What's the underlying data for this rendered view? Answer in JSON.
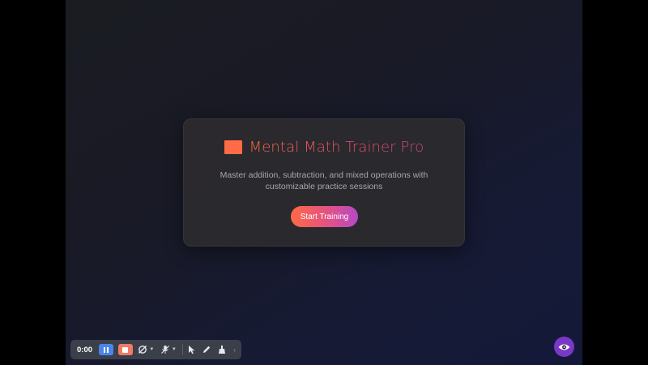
{
  "app": {
    "title": "Mental Math Trainer Pro",
    "subtitle": "Master addition, subtraction, and mixed operations with customizable practice sessions",
    "start_label": "Start Training",
    "icon": "orange-rectangle-icon"
  },
  "colors": {
    "accent_orange": "#ff6b47",
    "accent_pink": "#e0508a",
    "accent_purple": "#b34ac6",
    "eye_button": "#7a38c7",
    "pause_button": "#4a86e8",
    "stop_button": "#f07a66"
  },
  "toolbar": {
    "timer": "0:00",
    "icons": [
      "pause-icon",
      "stop-icon",
      "no-camera-icon",
      "no-microphone-icon",
      "cursor-icon",
      "pen-icon",
      "eraser-icon"
    ]
  }
}
